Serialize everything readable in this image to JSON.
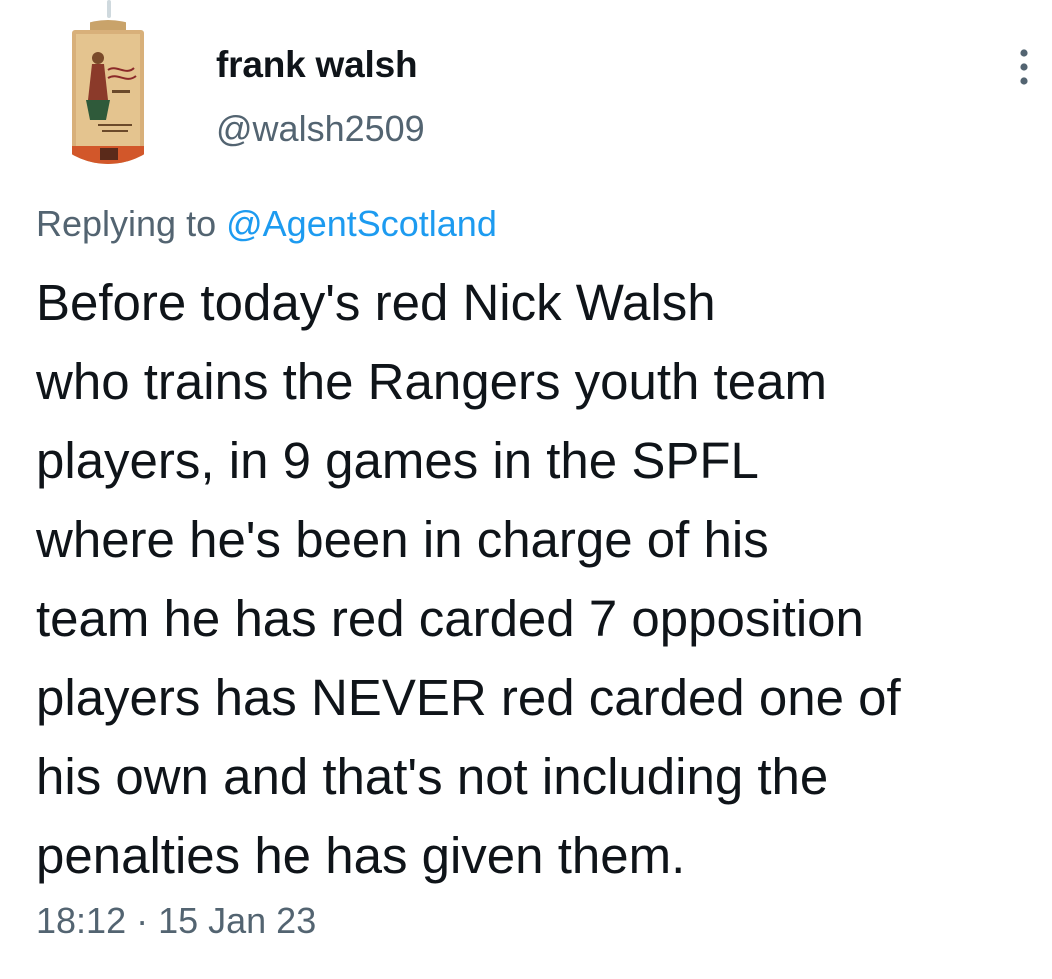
{
  "author": {
    "display_name": "frank walsh",
    "handle": "@walsh2509",
    "avatar_icon": "bottle-label-avatar-icon"
  },
  "more_icon": "more-options-icon",
  "reply_context": {
    "prefix": "Replying to",
    "mention": "@AgentScotland"
  },
  "tweet": {
    "lines": [
      "Before today's red Nick Walsh",
      "who trains the Rangers youth team",
      "players, in 9 games in the SPFL",
      "where he's been in charge of his",
      "team he has red carded 7 opposition",
      "players has NEVER red carded one of",
      "his own and that's not including the",
      "penalties he has given them."
    ],
    "timestamp": "18:12 · 15 Jan 23"
  },
  "colors": {
    "text": "#0f1419",
    "secondary": "#536471",
    "link": "#1d9bf0",
    "thread_line": "#cfd9de"
  }
}
